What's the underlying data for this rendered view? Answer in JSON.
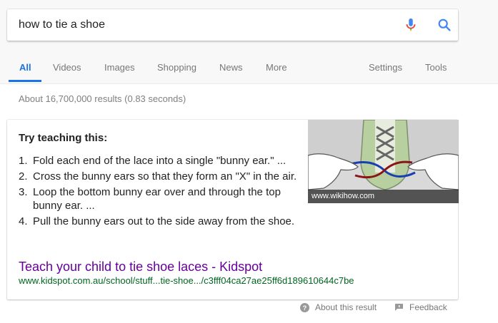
{
  "search": {
    "query": "how to tie a shoe"
  },
  "tabs": [
    {
      "label": "All"
    },
    {
      "label": "Videos"
    },
    {
      "label": "Images"
    },
    {
      "label": "Shopping"
    },
    {
      "label": "News"
    },
    {
      "label": "More"
    },
    {
      "label": "Settings"
    },
    {
      "label": "Tools"
    }
  ],
  "results_count": "About 16,700,000 results (0.83 seconds)",
  "featured_snippet": {
    "heading": "Try teaching this:",
    "steps": [
      {
        "num": "1.",
        "text": "Fold each end of the lace into a single \"bunny ear.\" ..."
      },
      {
        "num": "2.",
        "text": "Cross the bunny ears so that they form an \"X\" in the air."
      },
      {
        "num": "3.",
        "text": "Loop the bottom bunny ear over and through the top bunny ear. ..."
      },
      {
        "num": "4.",
        "text": "Pull the bunny ears out to the side away from the shoe."
      }
    ],
    "image_caption": "www.wikihow.com",
    "result_title": "Teach your child to tie shoe laces - Kidspot",
    "result_url": "www.kidspot.com.au/school/stuff...tie-shoe.../c3fff04ca27ae25ff6d189610644c7be"
  },
  "footer": {
    "about": "About this result",
    "feedback": "Feedback"
  },
  "colors": {
    "accent": "#1a73e8",
    "visited_link": "#660099",
    "url_green": "#006621"
  }
}
